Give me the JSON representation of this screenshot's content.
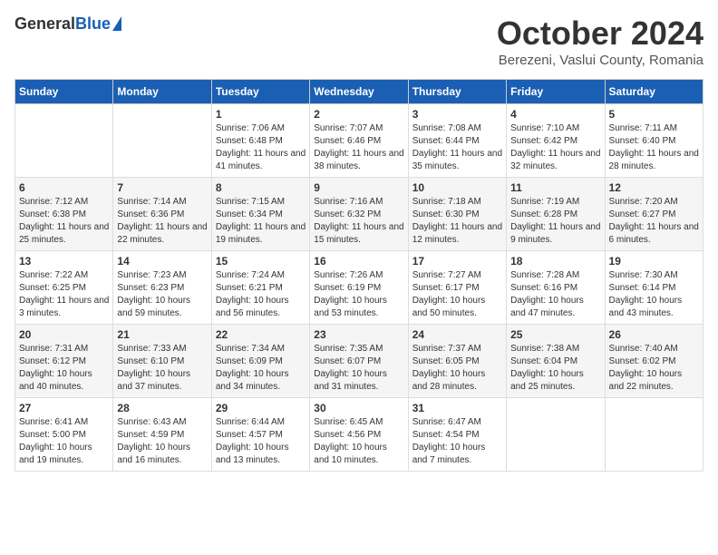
{
  "header": {
    "logo_general": "General",
    "logo_blue": "Blue",
    "month_title": "October 2024",
    "subtitle": "Berezeni, Vaslui County, Romania"
  },
  "days_of_week": [
    "Sunday",
    "Monday",
    "Tuesday",
    "Wednesday",
    "Thursday",
    "Friday",
    "Saturday"
  ],
  "weeks": [
    [
      {
        "day": "",
        "info": ""
      },
      {
        "day": "",
        "info": ""
      },
      {
        "day": "1",
        "sunrise": "Sunrise: 7:06 AM",
        "sunset": "Sunset: 6:48 PM",
        "daylight": "Daylight: 11 hours and 41 minutes."
      },
      {
        "day": "2",
        "sunrise": "Sunrise: 7:07 AM",
        "sunset": "Sunset: 6:46 PM",
        "daylight": "Daylight: 11 hours and 38 minutes."
      },
      {
        "day": "3",
        "sunrise": "Sunrise: 7:08 AM",
        "sunset": "Sunset: 6:44 PM",
        "daylight": "Daylight: 11 hours and 35 minutes."
      },
      {
        "day": "4",
        "sunrise": "Sunrise: 7:10 AM",
        "sunset": "Sunset: 6:42 PM",
        "daylight": "Daylight: 11 hours and 32 minutes."
      },
      {
        "day": "5",
        "sunrise": "Sunrise: 7:11 AM",
        "sunset": "Sunset: 6:40 PM",
        "daylight": "Daylight: 11 hours and 28 minutes."
      }
    ],
    [
      {
        "day": "6",
        "sunrise": "Sunrise: 7:12 AM",
        "sunset": "Sunset: 6:38 PM",
        "daylight": "Daylight: 11 hours and 25 minutes."
      },
      {
        "day": "7",
        "sunrise": "Sunrise: 7:14 AM",
        "sunset": "Sunset: 6:36 PM",
        "daylight": "Daylight: 11 hours and 22 minutes."
      },
      {
        "day": "8",
        "sunrise": "Sunrise: 7:15 AM",
        "sunset": "Sunset: 6:34 PM",
        "daylight": "Daylight: 11 hours and 19 minutes."
      },
      {
        "day": "9",
        "sunrise": "Sunrise: 7:16 AM",
        "sunset": "Sunset: 6:32 PM",
        "daylight": "Daylight: 11 hours and 15 minutes."
      },
      {
        "day": "10",
        "sunrise": "Sunrise: 7:18 AM",
        "sunset": "Sunset: 6:30 PM",
        "daylight": "Daylight: 11 hours and 12 minutes."
      },
      {
        "day": "11",
        "sunrise": "Sunrise: 7:19 AM",
        "sunset": "Sunset: 6:28 PM",
        "daylight": "Daylight: 11 hours and 9 minutes."
      },
      {
        "day": "12",
        "sunrise": "Sunrise: 7:20 AM",
        "sunset": "Sunset: 6:27 PM",
        "daylight": "Daylight: 11 hours and 6 minutes."
      }
    ],
    [
      {
        "day": "13",
        "sunrise": "Sunrise: 7:22 AM",
        "sunset": "Sunset: 6:25 PM",
        "daylight": "Daylight: 11 hours and 3 minutes."
      },
      {
        "day": "14",
        "sunrise": "Sunrise: 7:23 AM",
        "sunset": "Sunset: 6:23 PM",
        "daylight": "Daylight: 10 hours and 59 minutes."
      },
      {
        "day": "15",
        "sunrise": "Sunrise: 7:24 AM",
        "sunset": "Sunset: 6:21 PM",
        "daylight": "Daylight: 10 hours and 56 minutes."
      },
      {
        "day": "16",
        "sunrise": "Sunrise: 7:26 AM",
        "sunset": "Sunset: 6:19 PM",
        "daylight": "Daylight: 10 hours and 53 minutes."
      },
      {
        "day": "17",
        "sunrise": "Sunrise: 7:27 AM",
        "sunset": "Sunset: 6:17 PM",
        "daylight": "Daylight: 10 hours and 50 minutes."
      },
      {
        "day": "18",
        "sunrise": "Sunrise: 7:28 AM",
        "sunset": "Sunset: 6:16 PM",
        "daylight": "Daylight: 10 hours and 47 minutes."
      },
      {
        "day": "19",
        "sunrise": "Sunrise: 7:30 AM",
        "sunset": "Sunset: 6:14 PM",
        "daylight": "Daylight: 10 hours and 43 minutes."
      }
    ],
    [
      {
        "day": "20",
        "sunrise": "Sunrise: 7:31 AM",
        "sunset": "Sunset: 6:12 PM",
        "daylight": "Daylight: 10 hours and 40 minutes."
      },
      {
        "day": "21",
        "sunrise": "Sunrise: 7:33 AM",
        "sunset": "Sunset: 6:10 PM",
        "daylight": "Daylight: 10 hours and 37 minutes."
      },
      {
        "day": "22",
        "sunrise": "Sunrise: 7:34 AM",
        "sunset": "Sunset: 6:09 PM",
        "daylight": "Daylight: 10 hours and 34 minutes."
      },
      {
        "day": "23",
        "sunrise": "Sunrise: 7:35 AM",
        "sunset": "Sunset: 6:07 PM",
        "daylight": "Daylight: 10 hours and 31 minutes."
      },
      {
        "day": "24",
        "sunrise": "Sunrise: 7:37 AM",
        "sunset": "Sunset: 6:05 PM",
        "daylight": "Daylight: 10 hours and 28 minutes."
      },
      {
        "day": "25",
        "sunrise": "Sunrise: 7:38 AM",
        "sunset": "Sunset: 6:04 PM",
        "daylight": "Daylight: 10 hours and 25 minutes."
      },
      {
        "day": "26",
        "sunrise": "Sunrise: 7:40 AM",
        "sunset": "Sunset: 6:02 PM",
        "daylight": "Daylight: 10 hours and 22 minutes."
      }
    ],
    [
      {
        "day": "27",
        "sunrise": "Sunrise: 6:41 AM",
        "sunset": "Sunset: 5:00 PM",
        "daylight": "Daylight: 10 hours and 19 minutes."
      },
      {
        "day": "28",
        "sunrise": "Sunrise: 6:43 AM",
        "sunset": "Sunset: 4:59 PM",
        "daylight": "Daylight: 10 hours and 16 minutes."
      },
      {
        "day": "29",
        "sunrise": "Sunrise: 6:44 AM",
        "sunset": "Sunset: 4:57 PM",
        "daylight": "Daylight: 10 hours and 13 minutes."
      },
      {
        "day": "30",
        "sunrise": "Sunrise: 6:45 AM",
        "sunset": "Sunset: 4:56 PM",
        "daylight": "Daylight: 10 hours and 10 minutes."
      },
      {
        "day": "31",
        "sunrise": "Sunrise: 6:47 AM",
        "sunset": "Sunset: 4:54 PM",
        "daylight": "Daylight: 10 hours and 7 minutes."
      },
      {
        "day": "",
        "info": ""
      },
      {
        "day": "",
        "info": ""
      }
    ]
  ]
}
